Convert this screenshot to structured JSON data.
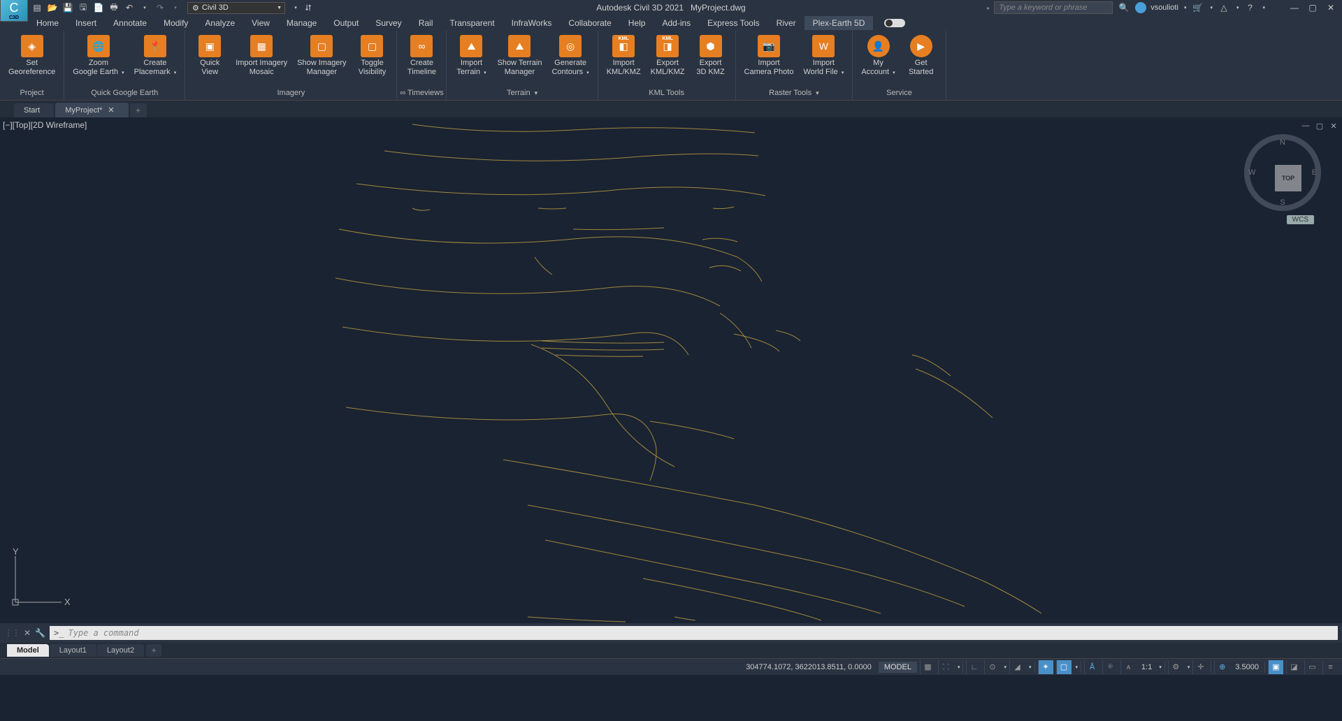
{
  "titlebar": {
    "app": "C3D",
    "workspace": "Civil 3D",
    "app_name": "Autodesk Civil 3D 2021",
    "file": "MyProject.dwg",
    "search_placeholder": "Type a keyword or phrase",
    "user": "vsoulioti"
  },
  "menu": [
    "Home",
    "Insert",
    "Annotate",
    "Modify",
    "Analyze",
    "View",
    "Manage",
    "Output",
    "Survey",
    "Rail",
    "Transparent",
    "InfraWorks",
    "Collaborate",
    "Help",
    "Add-ins",
    "Express Tools",
    "River",
    "Plex-Earth 5D"
  ],
  "menu_active": "Plex-Earth 5D",
  "ribbon": [
    {
      "label": "Project",
      "buttons": [
        {
          "l1": "Set",
          "l2": "Georeference",
          "icon": "◈"
        }
      ]
    },
    {
      "label": "Quick Google Earth",
      "buttons": [
        {
          "l1": "Zoom",
          "l2": "Google Earth",
          "icon": "🌐",
          "dd": true
        },
        {
          "l1": "Create",
          "l2": "Placemark",
          "icon": "📍",
          "dd": true
        }
      ]
    },
    {
      "label": "Imagery",
      "buttons": [
        {
          "l1": "Quick",
          "l2": "View",
          "icon": "▣"
        },
        {
          "l1": "Import Imagery",
          "l2": "Mosaic",
          "icon": "▦"
        },
        {
          "l1": "Show Imagery",
          "l2": "Manager",
          "icon": "▢"
        },
        {
          "l1": "Toggle",
          "l2": "Visibility",
          "icon": "▢"
        }
      ]
    },
    {
      "label": "∞ Timeviews",
      "buttons": [
        {
          "l1": "Create",
          "l2": "Timeline",
          "icon": "∞"
        }
      ]
    },
    {
      "label": "Terrain",
      "dd": true,
      "buttons": [
        {
          "l1": "Import",
          "l2": "Terrain",
          "icon": "⛰",
          "dd": true
        },
        {
          "l1": "Show Terrain",
          "l2": "Manager",
          "icon": "⛰"
        },
        {
          "l1": "Generate",
          "l2": "Contours",
          "icon": "◎",
          "dd": true
        }
      ]
    },
    {
      "label": "KML Tools",
      "buttons": [
        {
          "l1": "Import",
          "l2": "KML/KMZ",
          "icon": "◧",
          "kml": true
        },
        {
          "l1": "Export",
          "l2": "KML/KMZ",
          "icon": "◨",
          "kml": true
        },
        {
          "l1": "Export",
          "l2": "3D KMZ",
          "icon": "⬢"
        }
      ]
    },
    {
      "label": "Raster Tools",
      "dd": true,
      "buttons": [
        {
          "l1": "Import",
          "l2": "Camera Photo",
          "icon": "📷"
        },
        {
          "l1": "Import",
          "l2": "World File",
          "icon": "W",
          "dd": true
        }
      ]
    },
    {
      "label": "Service",
      "buttons": [
        {
          "l1": "My",
          "l2": "Account",
          "icon": "👤",
          "cls": "person",
          "dd": true
        },
        {
          "l1": "Get",
          "l2": "Started",
          "icon": "▶",
          "cls": "play"
        }
      ]
    }
  ],
  "doc_tabs": [
    {
      "label": "Start",
      "active": false,
      "closable": false
    },
    {
      "label": "MyProject*",
      "active": true,
      "closable": true
    }
  ],
  "viewport": {
    "label": "[−][Top][2D Wireframe]",
    "viewcube": "TOP",
    "compass": {
      "n": "N",
      "s": "S",
      "e": "E",
      "w": "W"
    },
    "wcs": "WCS",
    "ucs": {
      "x": "X",
      "y": "Y"
    }
  },
  "cmd": {
    "placeholder": "Type a command",
    "prompt": ">_"
  },
  "layout_tabs": [
    "Model",
    "Layout1",
    "Layout2"
  ],
  "layout_active": "Model",
  "status": {
    "coords": "304774.1072, 3622013.8511, 0.0000",
    "model": "MODEL",
    "scale_ratio": "1:1",
    "anno_scale": "3.5000"
  }
}
